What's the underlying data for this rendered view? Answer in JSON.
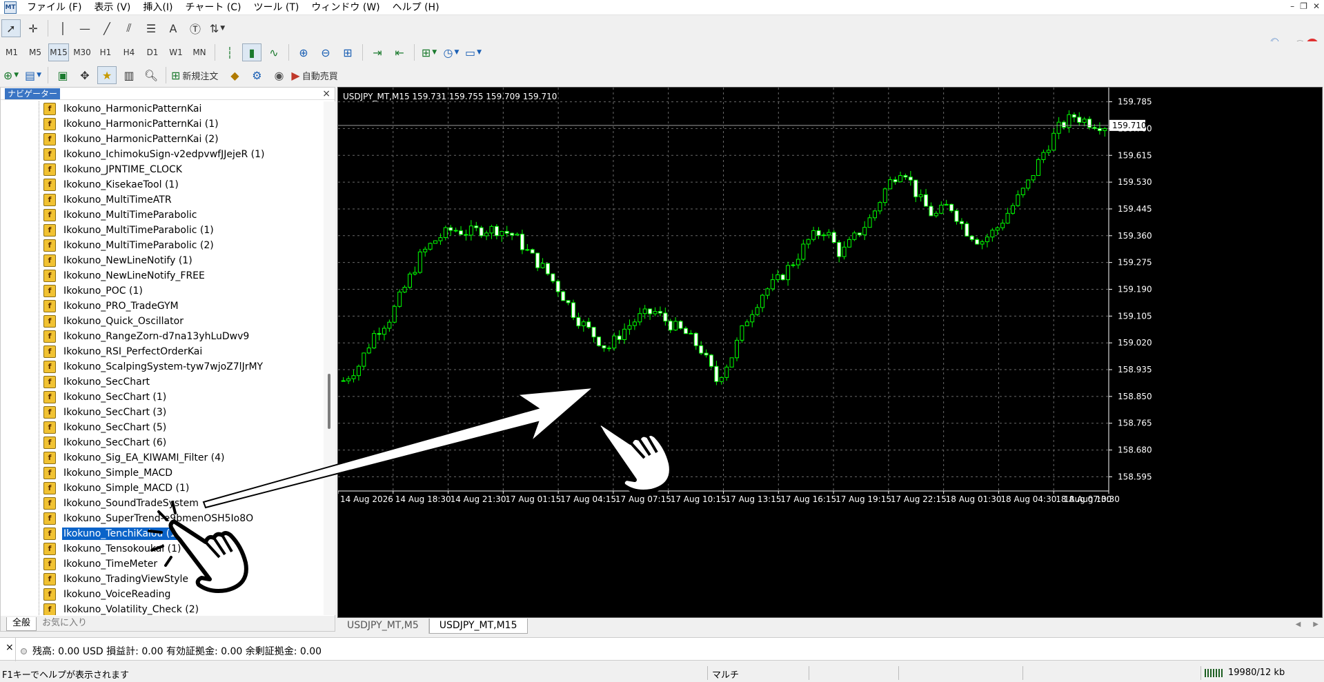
{
  "menubar": {
    "app_icon": "mt4-app-icon",
    "items": [
      "ファイル (F)",
      "表示 (V)",
      "挿入(I)",
      "チャート (C)",
      "ツール (T)",
      "ウィンドウ (W)",
      "ヘルプ (H)"
    ]
  },
  "toolbar_timeframes": [
    "M1",
    "M5",
    "M15",
    "M30",
    "H1",
    "H4",
    "D1",
    "W1",
    "MN"
  ],
  "toolbar_active_timeframe": "M15",
  "toolbar": {
    "new_order_label": "新規注文",
    "auto_trade_label": "自動売買",
    "notification_count": "1"
  },
  "navigator": {
    "title": "ナビゲーター",
    "close": "×",
    "items": [
      "Ikokuno_HarmonicPatternKai",
      "Ikokuno_HarmonicPatternKai (1)",
      "Ikokuno_HarmonicPatternKai (2)",
      "Ikokuno_IchimokuSign-v2edpvwfJJejeR (1)",
      "Ikokuno_JPNTIME_CLOCK",
      "Ikokuno_KisekaeTool (1)",
      "Ikokuno_MultiTimeATR",
      "Ikokuno_MultiTimeParabolic",
      "Ikokuno_MultiTimeParabolic (1)",
      "Ikokuno_MultiTimeParabolic (2)",
      "Ikokuno_NewLineNotify (1)",
      "Ikokuno_NewLineNotify_FREE",
      "Ikokuno_POC (1)",
      "Ikokuno_PRO_TradeGYM",
      "Ikokuno_Quick_Oscillator",
      "Ikokuno_RangeZorn-d7na13yhLuDwv9",
      "Ikokuno_RSI_PerfectOrderKai",
      "Ikokuno_ScalpingSystem-tyw7wjoZ7lJrMY",
      "Ikokuno_SecChart",
      "Ikokuno_SecChart (1)",
      "Ikokuno_SecChart (3)",
      "Ikokuno_SecChart (5)",
      "Ikokuno_SecChart (6)",
      "Ikokuno_Sig_EA_KIWAMI_Filter (4)",
      "Ikokuno_Simple_MACD",
      "Ikokuno_Simple_MACD (1)",
      "Ikokuno_SoundTradeSystem",
      "Ikokuno_SuperTrend-e9bmenOSH5Io8O",
      "Ikokuno_TenchiKaiou (1)",
      "Ikokuno_Tensokoukai (1)",
      "Ikokuno_TimeMeter",
      "Ikokuno_TradingViewStyle",
      "Ikokuno_VoiceReading",
      "Ikokuno_Volatility_Check (2)"
    ],
    "selected_index": 28,
    "tabs": [
      "全般",
      "お気に入り"
    ]
  },
  "chart": {
    "info": "USDJPY_MT,M15  159.731 159.755 159.709 159.710",
    "current_price": "159.710",
    "y_labels": [
      "159.785",
      "159.700",
      "159.615",
      "159.530",
      "159.445",
      "159.360",
      "159.275",
      "159.190",
      "159.105",
      "159.020",
      "158.935",
      "158.850",
      "158.765",
      "158.680",
      "158.595"
    ],
    "x_labels": [
      "14 Aug 2026",
      "14 Aug 18:30",
      "14 Aug 21:30",
      "17 Aug 01:15",
      "17 Aug 04:15",
      "17 Aug 07:15",
      "17 Aug 10:15",
      "17 Aug 13:15",
      "17 Aug 16:15",
      "17 Aug 19:15",
      "17 Aug 22:15",
      "18 Aug 01:30",
      "18 Aug 04:30",
      "18 Aug 07:30",
      "18 Aug 10:30"
    ],
    "colors": {
      "background": "#000000",
      "candle": "#00ff00",
      "grid": "#6b6b6b",
      "axis_text": "#ffffff"
    },
    "tabs": [
      "USDJPY_MT,M5",
      "USDJPY_MT,M15"
    ],
    "active_tab": "USDJPY_MT,M15"
  },
  "chart_data": {
    "type": "candlestick",
    "symbol": "USDJPY_MT",
    "timeframe": "M15",
    "ylim": [
      158.55,
      159.83
    ],
    "close_path": [
      158.9,
      158.95,
      159.05,
      159.1,
      159.2,
      159.3,
      159.35,
      159.38,
      159.37,
      159.38,
      159.38,
      159.36,
      159.3,
      159.25,
      159.18,
      159.1,
      159.05,
      159.0,
      159.06,
      159.1,
      159.12,
      159.08,
      159.05,
      159.0,
      158.9,
      158.98,
      159.1,
      159.18,
      159.22,
      159.28,
      159.35,
      159.38,
      159.3,
      159.36,
      159.42,
      159.52,
      159.58,
      159.48,
      159.42,
      159.46,
      159.38,
      159.34,
      159.38,
      159.45,
      159.52,
      159.62,
      159.7,
      159.74,
      159.72,
      159.71
    ]
  },
  "terminal": {
    "close": "×",
    "account_line": "残高: 0.00 USD  損益計: 0.00  有効証拠金: 0.00  余剰証拠金: 0.00"
  },
  "status": {
    "help": "F1キーでヘルプが表示されます",
    "profile": "マルチ",
    "traffic": "19980/12 kb"
  }
}
